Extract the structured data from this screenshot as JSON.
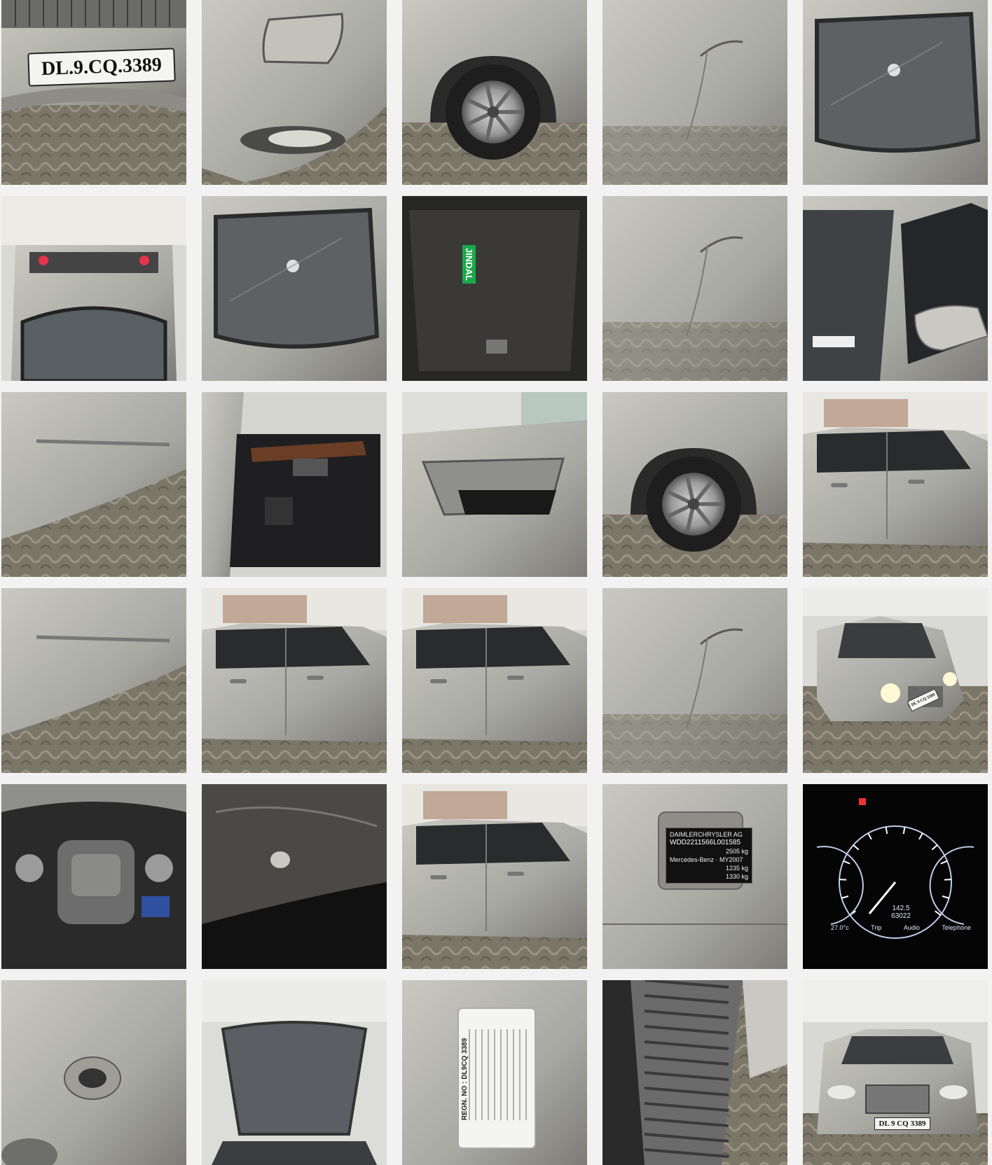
{
  "gallery": {
    "tiles": [
      {
        "id": "front-plate",
        "kind": "plate"
      },
      {
        "id": "front-bumper-left",
        "kind": "bumper"
      },
      {
        "id": "front-wheel-fender",
        "kind": "wheel"
      },
      {
        "id": "door-scratch",
        "kind": "panel"
      },
      {
        "id": "windshield",
        "kind": "glass"
      },
      {
        "id": "trunk-open",
        "kind": "trunk"
      },
      {
        "id": "rear-glass",
        "kind": "glass"
      },
      {
        "id": "trunk-floor",
        "kind": "trunkfloor"
      },
      {
        "id": "rear-quarter-scratch",
        "kind": "panel"
      },
      {
        "id": "side-mirror-window",
        "kind": "mirror"
      },
      {
        "id": "side-sill",
        "kind": "sill"
      },
      {
        "id": "door-interior-panel",
        "kind": "doorpanel"
      },
      {
        "id": "sunroof",
        "kind": "sunroof"
      },
      {
        "id": "front-wheel-right",
        "kind": "wheel"
      },
      {
        "id": "side-profile-front",
        "kind": "profile"
      },
      {
        "id": "side-sill-rear",
        "kind": "sill"
      },
      {
        "id": "side-doors-left",
        "kind": "profile"
      },
      {
        "id": "side-doors-rear",
        "kind": "profile"
      },
      {
        "id": "wheel-arch-detail",
        "kind": "panel"
      },
      {
        "id": "front-lights-on",
        "kind": "frontlit"
      },
      {
        "id": "engine-bay",
        "kind": "engine"
      },
      {
        "id": "underbody",
        "kind": "dark"
      },
      {
        "id": "rear-side-profile",
        "kind": "profile"
      },
      {
        "id": "vin-plate",
        "kind": "vin"
      },
      {
        "id": "instrument-cluster",
        "kind": "dash"
      },
      {
        "id": "fuel-cap-badge",
        "kind": "fuel"
      },
      {
        "id": "hood-open",
        "kind": "hood"
      },
      {
        "id": "registration-sticker",
        "kind": "sticker"
      },
      {
        "id": "tyre-tread",
        "kind": "tyre"
      },
      {
        "id": "front-full-view",
        "kind": "frontfull"
      }
    ]
  },
  "texts": {
    "plate_front": "DL.9.CQ.3389",
    "plate_small": "DL 9 CQ 3389",
    "trunk_tag": "JINDAL",
    "vin_brand": "DAIMLERCHRYSLER AG",
    "vin_number": "WDD2211566L001585",
    "vin_weight_1": "2505 kg",
    "vin_weight_2": "1235 kg",
    "vin_weight_3": "1330 kg",
    "vin_maker": "Mercedes-Benz",
    "vin_my": "MY2007",
    "dash_temp": "27.0°c",
    "dash_trip": "Trip",
    "dash_audio": "Audio",
    "dash_tel": "Telephone",
    "dash_km1": "142.5",
    "dash_km2": "63022",
    "sticker_reg": "REGN. NO : DL9CQ 3389"
  },
  "colors": {
    "silver": "#a9a9a3",
    "silver_light": "#c9c8c2",
    "silver_dark": "#7d7c77",
    "floor": "#7a7668",
    "floor_light": "#9a9585",
    "dark": "#1c1c1c",
    "glass": "#5d6163"
  }
}
